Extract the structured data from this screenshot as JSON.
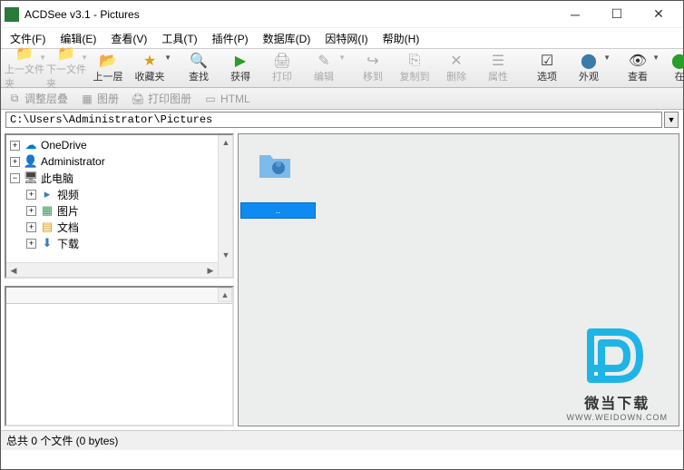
{
  "title": "ACDSee v3.1 - Pictures",
  "menus": [
    "文件(F)",
    "编辑(E)",
    "查看(V)",
    "工具(T)",
    "插件(P)",
    "数据库(D)",
    "因特网(I)",
    "帮助(H)"
  ],
  "toolbar": {
    "prev_folder": "上一文件夹",
    "next_folder": "下一文件夹",
    "up": "上一层",
    "fav": "收藏夹",
    "find": "查找",
    "acquire": "获得",
    "print": "打印",
    "edit": "编辑",
    "moveto": "移到",
    "copyto": "复制到",
    "delete": "删除",
    "properties": "属性",
    "options": "选项",
    "view": "外观",
    "browse": "查看",
    "online": "在"
  },
  "toolbar2": {
    "adjust": "调整层叠",
    "album": "图册",
    "printalbum": "打印图册",
    "html": "HTML"
  },
  "path": "C:\\Users\\Administrator\\Pictures",
  "tree": [
    {
      "indent": 0,
      "toggle": "+",
      "icon": "onedrive",
      "label": "OneDrive"
    },
    {
      "indent": 0,
      "toggle": "+",
      "icon": "user",
      "label": "Administrator"
    },
    {
      "indent": 0,
      "toggle": "−",
      "icon": "pc",
      "label": "此电脑"
    },
    {
      "indent": 1,
      "toggle": "+",
      "icon": "video",
      "label": "视频"
    },
    {
      "indent": 1,
      "toggle": "+",
      "icon": "picture",
      "label": "图片"
    },
    {
      "indent": 1,
      "toggle": "+",
      "icon": "doc",
      "label": "文档"
    },
    {
      "indent": 1,
      "toggle": "+",
      "icon": "download",
      "label": "下载"
    }
  ],
  "selected_label": "..",
  "status": "总共 0 个文件 (0 bytes)",
  "watermark": {
    "line1": "微当下载",
    "line2": "WWW.WEIDOWN.COM"
  }
}
